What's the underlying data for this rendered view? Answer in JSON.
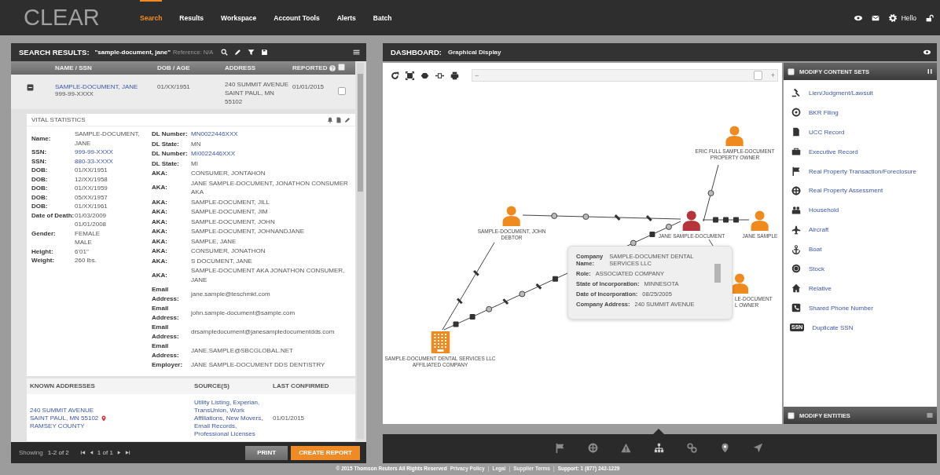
{
  "app": {
    "logo": "CLEAR",
    "nav": [
      {
        "label": "Search",
        "selected": true
      },
      {
        "label": "Results",
        "selected": false
      },
      {
        "label": "Workspace",
        "selected": false
      },
      {
        "label": "Account Tools",
        "selected": false
      },
      {
        "label": "Alerts",
        "selected": false
      },
      {
        "label": "Batch",
        "selected": false
      }
    ],
    "greeting": "Hello"
  },
  "search_panel": {
    "title": "SEARCH RESULTS:",
    "query": "\"sample-document, jane\"",
    "reference": "Reference: N/A",
    "columns": [
      "NAME / SSN",
      "DOB / AGE",
      "ADDRESS",
      "REPORTED"
    ],
    "result": {
      "expanded": true,
      "name": "SAMPLE-DOCUMENT, JANE",
      "ssn": "999-99-XXXX",
      "dob": "01/XX/1951",
      "address": [
        "240 SUMMIT AVENUE",
        "SAINT PAUL, MN",
        "55102"
      ],
      "reported": "01/01/2015",
      "checked": false
    },
    "vital_statistics": {
      "title": "VITAL STATISTICS",
      "left": [
        {
          "label": "Name:",
          "value": "SAMPLE-DOCUMENT, JANE",
          "kind": "text"
        },
        {
          "label": "SSN:",
          "value": "999-99-XXXX",
          "kind": "link"
        },
        {
          "label": "SSN:",
          "value": "880-33-XXXX",
          "kind": "link"
        },
        {
          "label": "DOB:",
          "value": "01/XX/1951",
          "kind": "text"
        },
        {
          "label": "DOB:",
          "value": "12/XX/1958",
          "kind": "text"
        },
        {
          "label": "DOB:",
          "value": "01/XX/1959",
          "kind": "text"
        },
        {
          "label": "DOB:",
          "value": "05/XX/1957",
          "kind": "text"
        },
        {
          "label": "DOB:",
          "value": "01/XX/1961",
          "kind": "text"
        },
        {
          "label": "Date of Death:",
          "value": "01/03/2009",
          "kind": "text"
        },
        {
          "value": "01/01/2008",
          "kind": "text"
        },
        {
          "label": "Gender:",
          "value": "FEMALE",
          "kind": "text"
        },
        {
          "value": "MALE",
          "kind": "text"
        },
        {
          "label": "Height:",
          "value": "6'01\"",
          "kind": "text"
        },
        {
          "label": "Weight:",
          "value": "260 lbs.",
          "kind": "text"
        }
      ],
      "right": [
        {
          "label": "DL Number:",
          "value": "MN0022446XXX",
          "kind": "link"
        },
        {
          "label": "DL State:",
          "value": "MN",
          "kind": "text"
        },
        {
          "label": "DL Number:",
          "value": "MI0022446XXX",
          "kind": "link"
        },
        {
          "label": "DL State:",
          "value": "MI",
          "kind": "text"
        },
        {
          "label": "AKA:",
          "value": "CONSUMER, JONTAHON",
          "kind": "text"
        },
        {
          "label": "AKA:",
          "value": "JANE SAMPLE-DOCUMENT, JONATHON CONSUMER AKA",
          "kind": "text"
        },
        {
          "label": "AKA:",
          "value": "SAMPLE-DOCUMENT, JILL",
          "kind": "text"
        },
        {
          "label": "AKA:",
          "value": "SAMPLE-DOCUMENT, JIM",
          "kind": "text"
        },
        {
          "label": "AKA:",
          "value": "SAMPLE-DOCUMENT, JOHN",
          "kind": "text"
        },
        {
          "label": "AKA:",
          "value": "SAMPLE-DOCUMENT, JOHNANDJANE",
          "kind": "text"
        },
        {
          "label": "AKA:",
          "value": "SAMPLE, JANE",
          "kind": "text"
        },
        {
          "label": "AKA:",
          "value": "CONSUMER, JONATHON",
          "kind": "text"
        },
        {
          "label": "AKA:",
          "value": "S DOCUMENT, JANE",
          "kind": "text"
        },
        {
          "label": "AKA:",
          "value": "SAMPLE-DOCUMENT AKA JONATHON CONSUMER, JANE",
          "kind": "text"
        },
        {
          "label": "Email Address:",
          "value": "jane.sample@teschmkt.com",
          "kind": "text"
        },
        {
          "label": "Email Address:",
          "value": "john.sample-document@sample.com",
          "kind": "text"
        },
        {
          "label": "Email Address:",
          "value": "drsampledocument@janesampledocumentdds.com",
          "kind": "text"
        },
        {
          "label": "Email Address:",
          "value": "JANE.SAMPLE@SBCGLOBAL.NET",
          "kind": "text"
        },
        {
          "label": "Employer:",
          "value": "JANE SAMPLE-DOCUMENT DDS DENTISTRY",
          "kind": "text"
        }
      ]
    },
    "known_addresses": {
      "columns": [
        "KNOWN ADDRESSES",
        "SOURCE(S)",
        "LAST CONFIRMED"
      ],
      "rows": [
        {
          "address": [
            "240 SUMMIT AVENUE",
            "SAINT PAUL, MN 55102",
            "RAMSEY COUNTY"
          ],
          "sources": "Utility Listing, Experian, TransUnion, Work Affiliations, New Movers, Email Records, Professional Licenses",
          "last_confirmed": "01/01/2015"
        }
      ]
    },
    "pager": {
      "showing": "Showing",
      "range": "1-2 of 2",
      "page": "1 of 1"
    },
    "buttons": [
      {
        "label": "PRINT",
        "kind": "secondary"
      },
      {
        "label": "CREATE REPORT",
        "kind": "primary"
      }
    ]
  },
  "dashboard": {
    "title": "DASHBOARD:",
    "subtitle": "Graphical Display",
    "zoom": {
      "minus": "−",
      "plus": "+",
      "level": 0.97
    },
    "graph": {
      "nodes": [
        {
          "label": "ERIC FULL SAMPLE-DOCUMENT",
          "role": "PROPERTY OWNER",
          "kind": "person",
          "color": "#ef8a1e"
        },
        {
          "label": "SAMPLE-DOCUMENT, JOHN",
          "role": "DEBTOR",
          "kind": "person",
          "color": "#ef8a1e"
        },
        {
          "label": "JANE SAMPLE-DOCUMENT",
          "kind": "person",
          "color": "#b5343a"
        },
        {
          "label": "JANE SAMPLE",
          "kind": "person",
          "color": "#ef8a1e"
        },
        {
          "label": "LE-DOCUMENT",
          "role": "L OWNER",
          "kind": "person",
          "color": "#ef8a1e"
        },
        {
          "label": "SAMPLE-DOCUMENT DENTAL SERVICES LLC",
          "role": "AFFILIATED COMPANY",
          "kind": "company",
          "color": "#ef8a1e"
        }
      ],
      "tooltip": {
        "rows": [
          {
            "label": "Company Name:",
            "value": "SAMPLE-DOCUMENT DENTAL SERVICES LLC"
          },
          {
            "label": "Role:",
            "value": "ASSOCIATED COMPANY"
          },
          {
            "label": "State of Incorporation:",
            "value": "MINNESOTA"
          },
          {
            "label": "Date of Incorporation:",
            "value": "08/25/2005"
          },
          {
            "label": "Company Address:",
            "value": "240 SUMMIT AVENUE"
          }
        ]
      }
    },
    "content_sets": {
      "title": "MODIFY CONTENT SETS",
      "items": [
        {
          "label": "Lien/Judgment/Lawsuit"
        },
        {
          "label": "BKR Filing"
        },
        {
          "label": "UCC Record"
        },
        {
          "label": "Executive Record"
        },
        {
          "label": "Real Property Transaction/Foreclosure"
        },
        {
          "label": "Real Property Assessment"
        },
        {
          "label": "Household"
        },
        {
          "label": "Aircraft"
        },
        {
          "label": "Boat"
        },
        {
          "label": "Stock"
        },
        {
          "label": "Relative"
        },
        {
          "label": "Shared Phone Number"
        },
        {
          "label": "Duplicate SSN",
          "icon_text": "SSN"
        }
      ],
      "entities_title": "MODIFY ENTITIES"
    },
    "toolbar": [
      {
        "selected": false
      },
      {
        "selected": false
      },
      {
        "selected": false
      },
      {
        "selected": true
      },
      {
        "selected": false
      },
      {
        "selected": false
      },
      {
        "selected": false
      }
    ]
  },
  "footer": [
    {
      "text": "© 2015 Thomson Reuters All Rights Reserved",
      "kind": "text"
    },
    {
      "text": "Privacy Policy",
      "kind": "link"
    },
    {
      "text": "|",
      "kind": "separator"
    },
    {
      "text": "Legal",
      "kind": "link"
    },
    {
      "text": "|",
      "kind": "separator"
    },
    {
      "text": "Supplier Terms",
      "kind": "link"
    },
    {
      "text": "|",
      "kind": "separator"
    },
    {
      "text": "Support: 1 (877) 242-1229",
      "kind": "text"
    }
  ]
}
